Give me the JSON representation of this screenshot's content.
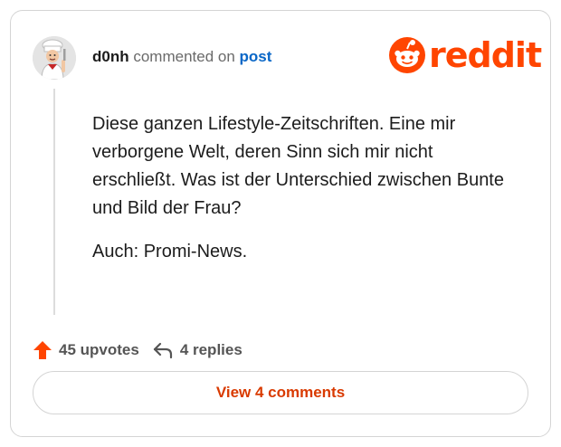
{
  "comment": {
    "username": "d0nh",
    "action_text": "commented on",
    "post_link_text": "post",
    "paragraphs": [
      "Diese ganzen Lifestyle-Zeitschriften. Eine mir verborgene Welt, deren Sinn sich mir nicht erschließt. Was ist der Unterschied zwischen Bunte und Bild der Frau?",
      "Auch: Promi-News."
    ]
  },
  "brand": {
    "wordmark": "reddit",
    "color": "#ff4500"
  },
  "stats": {
    "upvotes_label": "45 upvotes",
    "replies_label": "4 replies",
    "upvote_color": "#ff4500"
  },
  "actions": {
    "view_comments_label": "View 4 comments"
  },
  "icons": {
    "avatar": "chef-avatar",
    "logo": "reddit-snoo-icon",
    "upvote": "upvote-arrow-icon",
    "reply": "reply-arrow-icon"
  }
}
